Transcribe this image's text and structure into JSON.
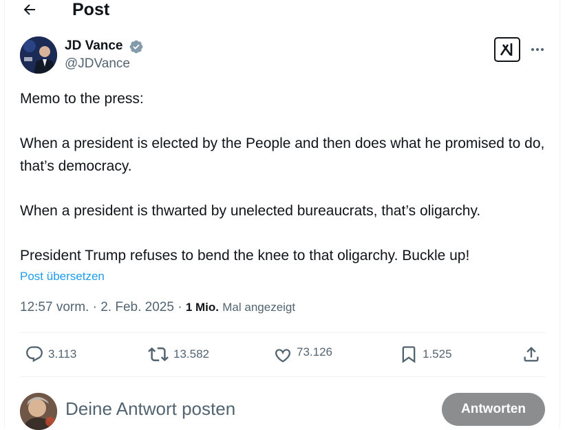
{
  "header": {
    "title": "Post",
    "back_icon": "arrow-left-icon"
  },
  "author": {
    "name": "JD Vance",
    "handle": "@JDVance",
    "verified_icon": "verified-badge-icon",
    "verified_color": "#829aab"
  },
  "post": {
    "text": "Memo to the press:\n\nWhen a president is elected by the People and then does what he promised to do, that’s democracy.\n\nWhen a president is thwarted by unelected bureaucrats, that’s oligarchy.\n\nPresident Trump refuses to bend the knee to that oligarchy. Buckle up!",
    "translate_label": "Post übersetzen",
    "time": "12:57 vorm.",
    "separator": " · ",
    "date": "2. Feb. 2025",
    "views_count": "1 Mio.",
    "views_label": "Mal angezeigt"
  },
  "actions": {
    "replies": "3.113",
    "reposts": "13.582",
    "likes": "73.126",
    "bookmarks": "1.525"
  },
  "reply": {
    "placeholder": "Deine Antwort posten",
    "button_label": "Antworten"
  },
  "colors": {
    "accent": "#1d9bf0",
    "secondary_text": "#536471",
    "button_disabled": "#8b8d8f"
  }
}
